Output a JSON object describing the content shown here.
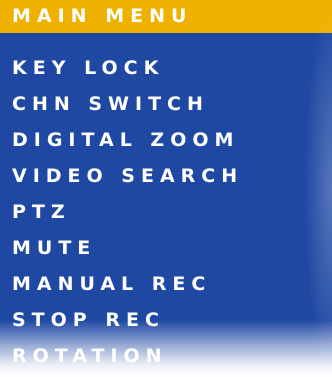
{
  "menu": {
    "title": "MAIN MENU",
    "items": [
      "KEY LOCK",
      "CHN SWITCH",
      "DIGITAL ZOOM",
      "VIDEO SEARCH",
      "PTZ",
      "MUTE",
      "MANUAL REC",
      "STOP REC",
      "ROTATION"
    ],
    "colors": {
      "background": "#1f48a3",
      "header_highlight": "#f0b000",
      "text": "#ffffff"
    }
  }
}
